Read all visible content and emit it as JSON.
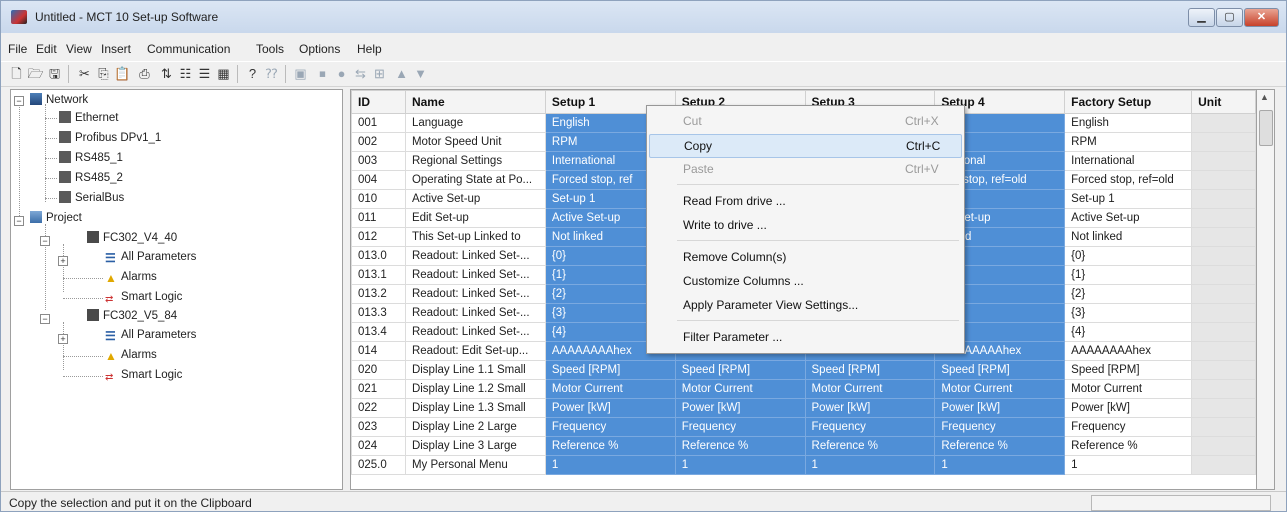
{
  "window": {
    "title": "Untitled - MCT 10 Set-up Software"
  },
  "menubar": [
    "File",
    "Edit",
    "View",
    "Insert",
    "Communication",
    "Tools",
    "Options",
    "Help"
  ],
  "tree": {
    "network": "Network",
    "ethernet": "Ethernet",
    "profibus": "Profibus DPv1_1",
    "rs485_1": "RS485_1",
    "rs485_2": "RS485_2",
    "serialbus": "SerialBus",
    "project": "Project",
    "drive1": "FC302_V4_40",
    "drive1_params": "All Parameters",
    "drive1_alarms": "Alarms",
    "drive1_logic": "Smart Logic",
    "drive2": "FC302_V5_84",
    "drive2_params": "All Parameters",
    "drive2_alarms": "Alarms",
    "drive2_logic": "Smart Logic"
  },
  "grid": {
    "columns": [
      "ID",
      "Name",
      "Setup 1",
      "Setup 2",
      "Setup 3",
      "Setup 4",
      "Factory Setup",
      "Unit"
    ],
    "rows": [
      [
        "001",
        "Language",
        "English",
        "",
        "",
        "lish",
        "English",
        ""
      ],
      [
        "002",
        "Motor Speed Unit",
        "RPM",
        "",
        "",
        "M",
        "RPM",
        ""
      ],
      [
        "003",
        "Regional Settings",
        "International",
        "",
        "",
        "rnational",
        "International",
        ""
      ],
      [
        "004",
        "Operating State at Po...",
        "Forced stop, ref",
        "",
        "",
        "ced stop, ref=old",
        "Forced stop, ref=old",
        ""
      ],
      [
        "010",
        "Active Set-up",
        "Set-up 1",
        "",
        "",
        "up 1",
        "Set-up 1",
        ""
      ],
      [
        "011",
        "Edit Set-up",
        "Active Set-up",
        "",
        "",
        "ve Set-up",
        "Active Set-up",
        ""
      ],
      [
        "012",
        "This Set-up Linked to",
        "Not linked",
        "",
        "",
        "linked",
        "Not linked",
        ""
      ],
      [
        "013.0",
        "Readout: Linked Set-...",
        "{0}",
        "",
        "",
        "",
        "{0}",
        ""
      ],
      [
        "013.1",
        "Readout: Linked Set-...",
        "{1}",
        "",
        "",
        "",
        "{1}",
        ""
      ],
      [
        "013.2",
        "Readout: Linked Set-...",
        "{2}",
        "",
        "",
        "",
        "{2}",
        ""
      ],
      [
        "013.3",
        "Readout: Linked Set-...",
        "{3}",
        "",
        "",
        "",
        "{3}",
        ""
      ],
      [
        "013.4",
        "Readout: Linked Set-...",
        "{4}",
        "",
        "",
        "",
        "{4}",
        ""
      ],
      [
        "014",
        "Readout: Edit Set-up...",
        "AAAAAAAAhex",
        "AAAAAAAAhex",
        "AAAAAAAAhex",
        "AAAAAAAAhex",
        "AAAAAAAAhex",
        ""
      ],
      [
        "020",
        "Display Line 1.1 Small",
        "Speed [RPM]",
        "Speed [RPM]",
        "Speed [RPM]",
        "Speed [RPM]",
        "Speed [RPM]",
        ""
      ],
      [
        "021",
        "Display Line 1.2 Small",
        "Motor Current",
        "Motor Current",
        "Motor Current",
        "Motor Current",
        "Motor Current",
        ""
      ],
      [
        "022",
        "Display Line 1.3 Small",
        "Power [kW]",
        "Power [kW]",
        "Power [kW]",
        "Power [kW]",
        "Power [kW]",
        ""
      ],
      [
        "023",
        "Display Line 2 Large",
        "Frequency",
        "Frequency",
        "Frequency",
        "Frequency",
        "Frequency",
        ""
      ],
      [
        "024",
        "Display Line 3 Large",
        "Reference %",
        "Reference %",
        "Reference %",
        "Reference %",
        "Reference %",
        ""
      ],
      [
        "025.0",
        "My Personal Menu",
        "1",
        "1",
        "1",
        "1",
        "1",
        ""
      ]
    ]
  },
  "context_menu": {
    "cut": "Cut",
    "cut_shortcut": "Ctrl+X",
    "copy": "Copy",
    "copy_shortcut": "Ctrl+C",
    "paste": "Paste",
    "paste_shortcut": "Ctrl+V",
    "read_from_drive": "Read From drive ...",
    "write_to_drive": "Write to drive ...",
    "remove_columns": "Remove Column(s)",
    "customize_columns": "Customize Columns ...",
    "apply_view_settings": "Apply Parameter View Settings...",
    "filter_parameter": "Filter Parameter ..."
  },
  "status": {
    "text": "Copy the selection and put it on the Clipboard"
  },
  "colors": {
    "selection": "#4f8fd6",
    "title_bar": "#c9d8ec",
    "close_button": "#c7412a"
  }
}
